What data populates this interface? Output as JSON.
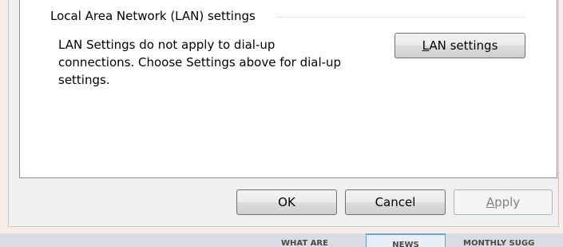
{
  "lan_group": {
    "title": "Local Area Network (LAN) settings",
    "description_lines": [
      "LAN Settings do not apply to dial-up",
      "connections. Choose Settings above for dial-up",
      "settings."
    ],
    "lan_button": {
      "mnemonic": "L",
      "rest": "AN settings"
    }
  },
  "footer": {
    "ok_label": "OK",
    "cancel_label": "Cancel",
    "apply_button": {
      "mnemonic": "A",
      "rest": "pply",
      "enabled": false
    }
  },
  "background_tabs": {
    "tab1": "WHAT ARE",
    "tab2": "NEWS",
    "tab3": "MONTHLY SUGG"
  },
  "colors": {
    "frame": "#f6ece8",
    "dialog_bg": "#f0f0f0",
    "panel_bg": "#ffffff",
    "disabled_text": "#838383"
  }
}
